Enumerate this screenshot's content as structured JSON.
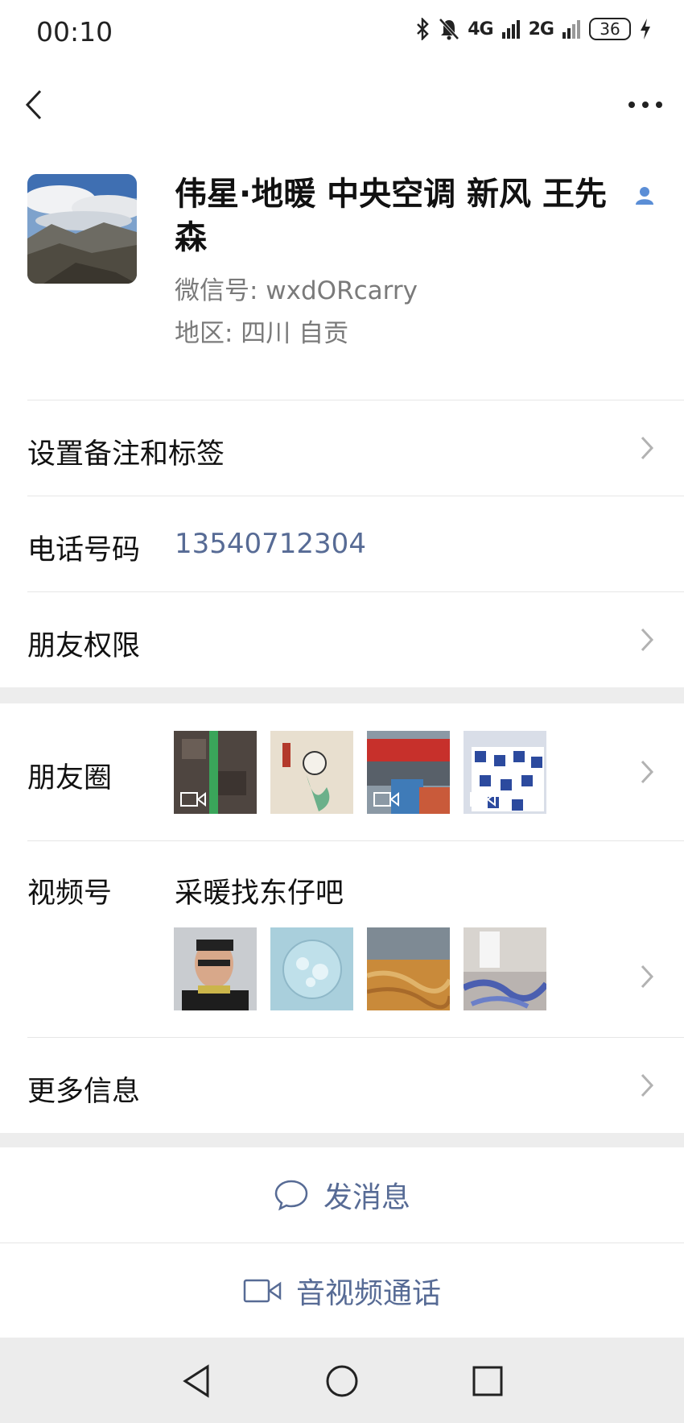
{
  "status_bar": {
    "time": "00:10",
    "network_4g": "4G",
    "network_2g": "2G",
    "battery": "36"
  },
  "icons": {
    "back": "chevron-left-icon",
    "more": "more-horizontal-icon",
    "message": "chat-bubble-icon",
    "video_call": "video-camera-icon"
  },
  "profile": {
    "name": "伟星·地暖 中央空调 新风 王先森",
    "wechat_id": "微信号: wxdORcarry",
    "region": "地区: 四川  自贡"
  },
  "rows": {
    "remark_tags": "设置备注和标签",
    "phone_label": "电话号码",
    "phone_value": "13540712304",
    "friend_permissions": "朋友权限",
    "moments": "朋友圈",
    "channels": "视频号",
    "channels_name": "采暖找东仔吧",
    "more_info": "更多信息"
  },
  "actions": {
    "send_message": "发消息",
    "av_call": "音视频通话"
  },
  "colors": {
    "link_blue": "#576b95",
    "separator_gray": "#ededed"
  }
}
